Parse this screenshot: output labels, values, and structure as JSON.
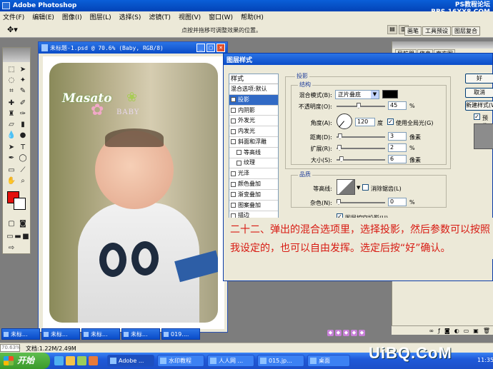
{
  "app": {
    "title": "Adobe Photoshop",
    "menu": [
      "文件(F)",
      "编辑(E)",
      "图像(I)",
      "图层(L)",
      "选择(S)",
      "滤镜(T)",
      "视图(V)",
      "窗口(W)",
      "帮助(H)"
    ],
    "watermark_line1": "PS教程论坛",
    "watermark_line2": "BBS.16XX8.COM"
  },
  "options_bar": {
    "hint": "点按并拖移可调整效果的位置。",
    "palette_tabs": [
      "画笔",
      "工具预设",
      "图层复合"
    ]
  },
  "document": {
    "title": "未标题-1.psd @ 70.6% (Baby, RGB/8)",
    "photo_logo": "Masato",
    "photo_logo_sub": "BABY"
  },
  "dialog": {
    "title": "图层样式",
    "styles_header": "样式",
    "styles": [
      {
        "label": "混合选项:默认",
        "checkbox": false,
        "checked": false,
        "selected": false,
        "sub": false
      },
      {
        "label": "投影",
        "checkbox": true,
        "checked": true,
        "selected": true,
        "sub": false
      },
      {
        "label": "内阴影",
        "checkbox": true,
        "checked": false,
        "selected": false,
        "sub": false
      },
      {
        "label": "外发光",
        "checkbox": true,
        "checked": false,
        "selected": false,
        "sub": false
      },
      {
        "label": "内发光",
        "checkbox": true,
        "checked": false,
        "selected": false,
        "sub": false
      },
      {
        "label": "斜面和浮雕",
        "checkbox": true,
        "checked": false,
        "selected": false,
        "sub": false
      },
      {
        "label": "等高线",
        "checkbox": true,
        "checked": false,
        "selected": false,
        "sub": true
      },
      {
        "label": "纹理",
        "checkbox": true,
        "checked": false,
        "selected": false,
        "sub": true
      },
      {
        "label": "光泽",
        "checkbox": true,
        "checked": false,
        "selected": false,
        "sub": false
      },
      {
        "label": "颜色叠加",
        "checkbox": true,
        "checked": false,
        "selected": false,
        "sub": false
      },
      {
        "label": "渐变叠加",
        "checkbox": true,
        "checked": false,
        "selected": false,
        "sub": false
      },
      {
        "label": "图案叠加",
        "checkbox": true,
        "checked": false,
        "selected": false,
        "sub": false
      },
      {
        "label": "描边",
        "checkbox": true,
        "checked": false,
        "selected": false,
        "sub": false
      }
    ],
    "shadow_group": "投影",
    "structure_group": "结构",
    "blend_mode_label": "混合模式(B):",
    "blend_mode_value": "正片叠底",
    "opacity_label": "不透明度(O):",
    "opacity_value": "45",
    "angle_label": "角度(A):",
    "angle_value": "120",
    "angle_unit": "度",
    "global_light_label": "使用全局光(G)",
    "distance_label": "距离(D):",
    "distance_value": "3",
    "spread_label": "扩展(R):",
    "spread_value": "2",
    "size_label": "大小(S):",
    "size_value": "6",
    "pixel_unit": "像素",
    "percent_unit": "%",
    "quality_group": "品质",
    "contour_label": "等高线:",
    "antialias_label": "消除锯齿(L)",
    "noise_label": "杂色(N):",
    "noise_value": "0",
    "knockout_label": "图层挖空投影(U)",
    "ok_label": "好",
    "cancel_label": "取消",
    "new_style_label": "新建样式(W)...",
    "preview_label": "预览"
  },
  "instruction": "二十二、弹出的混合选项里，选择投影，然后参数可以按照我设定的，也可以自由发挥。选定后按“好”确认。",
  "right_palette_tabs": [
    "导航器",
    "信息",
    "直方图"
  ],
  "minimized_windows": [
    "未标...",
    "未标...",
    "未标...",
    "未标...",
    "019...."
  ],
  "status": {
    "zoom": "70.63%",
    "doc_info": "文档:1.22M/2.49M"
  },
  "taskbar": {
    "start": "开始",
    "items": [
      "Adobe ...",
      "水印教程",
      "人人网 ...",
      "015.jp...",
      "桌面"
    ],
    "brand": "UiBQ.CoM",
    "time": "11:35"
  },
  "colors": {
    "foreground": "#e3100c",
    "background": "#ffffff",
    "shadow_color": "#000000",
    "instruction_text": "#d81a12"
  }
}
